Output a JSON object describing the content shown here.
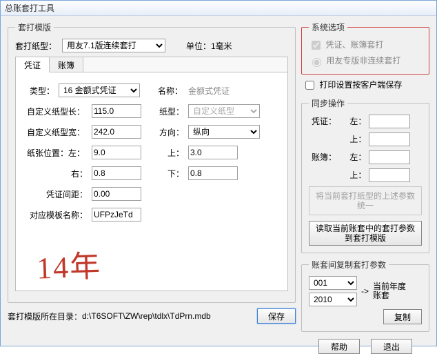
{
  "window": {
    "title": "总账套打工具"
  },
  "template": {
    "legend": "套打模版",
    "paper_type_label": "套打纸型：",
    "paper_type_value": "用友7.1版连续套打",
    "unit_label": "单位：1毫米",
    "tabs": {
      "voucher": "凭证",
      "book": "账簿"
    },
    "form": {
      "type_label": "类型：",
      "type_value": "16 金额式凭证",
      "name_label": "名称：",
      "name_value": "金额式凭证",
      "custom_len_label": "自定义纸型长：",
      "custom_len_value": "115.0",
      "paper_label": "纸型：",
      "paper_placeholder": "自定义纸型",
      "custom_w_label": "自定义纸型宽：",
      "custom_w_value": "242.0",
      "dir_label": "方向：",
      "dir_value": "纵向",
      "pos_left_label": "纸张位置：左：",
      "pos_left_value": "9.0",
      "pos_top_label": "上：",
      "pos_top_value": "3.0",
      "pos_right_label": "右：",
      "pos_right_value": "0.8",
      "pos_bottom_label": "下：",
      "pos_bottom_value": "0.8",
      "gap_label": "凭证间距：",
      "gap_value": "0.00",
      "tplname_label": "对应模板名称：",
      "tplname_value": "UFPzJeTd"
    },
    "path_label": "套打模版所在目录：",
    "path_value": "d:\\T6SOFT\\ZW\\rep\\tdlx\\TdPrn.mdb",
    "save_btn": "保存"
  },
  "options": {
    "legend": "系统选项",
    "opt1": "凭证、账簿套打",
    "opt2": "用友专版非连续套打",
    "opt3": "打印设置按客户端保存"
  },
  "sync": {
    "legend": "同步操作",
    "voucher_label": "凭证：",
    "book_label": "账簿：",
    "left_label": "左：",
    "top_label": "上：",
    "unify_text": "将当前套打纸型的上述参数统一",
    "read_btn": "读取当前账套中的套打参数到套打模版"
  },
  "copy": {
    "legend": "账套间复制套打参数",
    "src": "001",
    "dst": "2010",
    "arrow": "->",
    "note": "当前年度账套",
    "btn": "复制"
  },
  "footer": {
    "help": "帮助",
    "exit": "退出"
  },
  "annotation": "14年"
}
